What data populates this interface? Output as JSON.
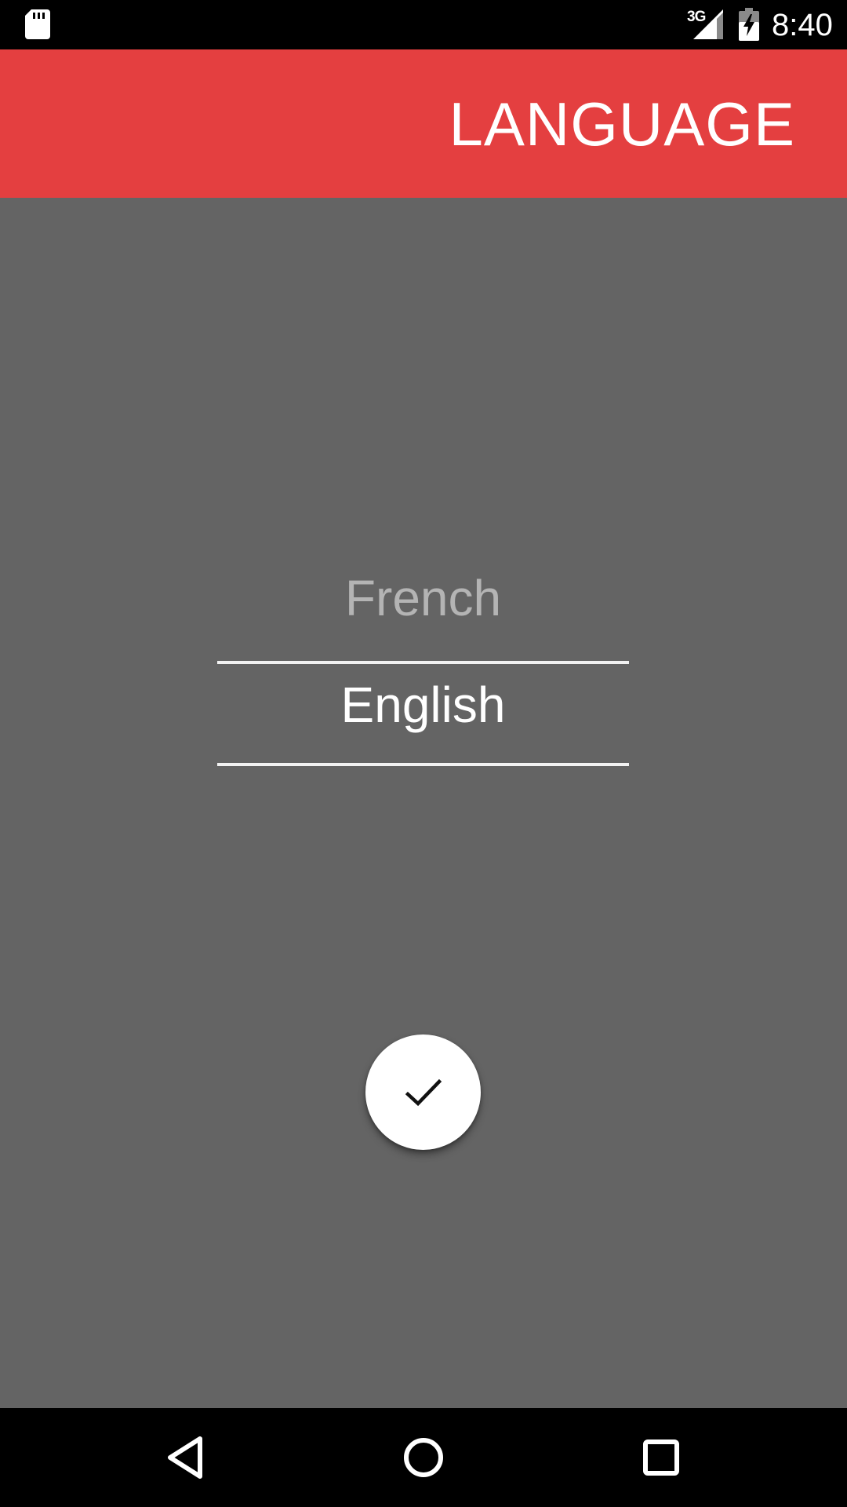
{
  "status_bar": {
    "network": "3G",
    "time": "8:40"
  },
  "app_bar": {
    "title": "LANGUAGE"
  },
  "language_picker": {
    "options": [
      "French",
      "English"
    ],
    "selected_index": 1
  },
  "icons": {
    "sd_card": "sd-card-icon",
    "signal": "signal-icon",
    "battery": "battery-charging-icon",
    "confirm": "check-icon",
    "back": "back-triangle-icon",
    "home": "home-circle-icon",
    "recents": "recents-square-icon"
  },
  "colors": {
    "app_bar": "#e43f40",
    "content_background": "#646464",
    "fab_background": "#ffffff",
    "picker_dim_text": "#b4b4b4",
    "picker_selected_text": "#ffffff"
  }
}
